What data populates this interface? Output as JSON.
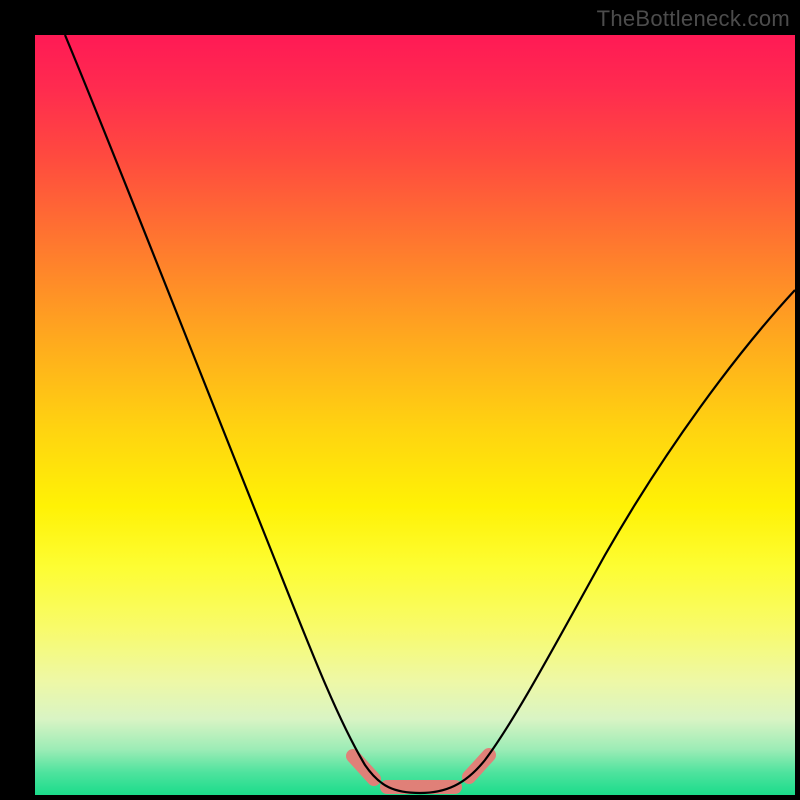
{
  "watermark": "TheBottleneck.com",
  "colors": {
    "frame_bg": "#000000",
    "curve": "#000000",
    "bottom_marker": "#e08078",
    "gradient_top": "#ff1a55",
    "gradient_mid": "#fff205",
    "gradient_bottom": "#1bdc8b"
  },
  "chart_data": {
    "type": "line",
    "title": "",
    "xlabel": "",
    "ylabel": "",
    "xlim": [
      0,
      100
    ],
    "ylim": [
      0,
      100
    ],
    "grid": false,
    "legend": false,
    "series": [
      {
        "name": "bottleneck-curve",
        "x": [
          4,
          10,
          16,
          22,
          28,
          34,
          38,
          41,
          43,
          45,
          47,
          50,
          53,
          56,
          60,
          66,
          74,
          82,
          90,
          100
        ],
        "y": [
          100,
          86,
          72,
          58,
          44,
          28,
          16,
          8,
          4,
          2,
          1,
          0.5,
          1,
          3,
          7,
          15,
          27,
          40,
          51,
          64
        ]
      }
    ],
    "annotations": [
      {
        "name": "optimal-zone-markers",
        "type": "segment-markers",
        "x_ranges": [
          [
            41.5,
            44.5
          ],
          [
            46,
            55.5
          ],
          [
            57,
            60
          ]
        ],
        "y": 1
      }
    ]
  }
}
